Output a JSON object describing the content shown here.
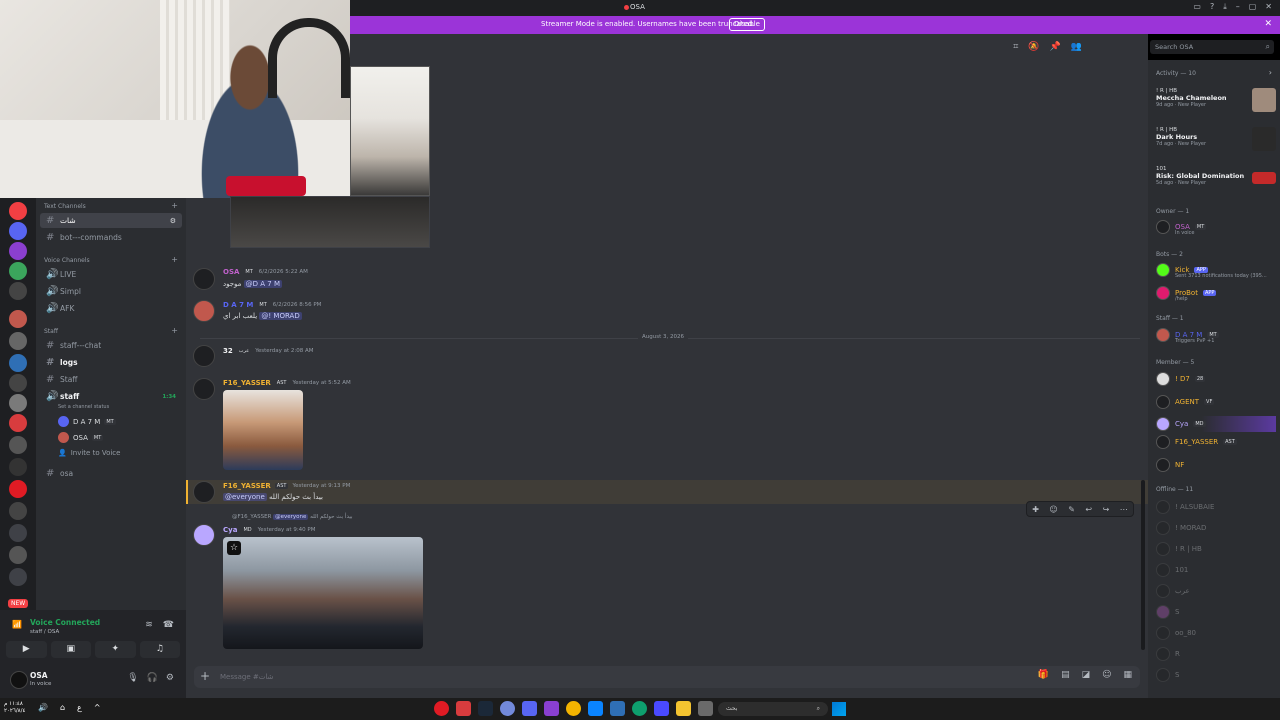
{
  "window": {
    "title": "OSA"
  },
  "banner": {
    "text": "Streamer Mode is enabled. Usernames have been truncated.",
    "button": "Disable"
  },
  "server_rail": {
    "new_badge": "NEW"
  },
  "channels": {
    "text_category": "Text Channels",
    "text_items": [
      {
        "name": "شات",
        "active": true
      },
      {
        "name": "bot---commands",
        "active": false
      }
    ],
    "voice_category": "Voice Channels",
    "voice_items": [
      "LIVE",
      "Simpl",
      "AFK"
    ],
    "staff_category": "Staff",
    "staff_items": [
      "staff---chat",
      "logs",
      "Staff"
    ],
    "staff_voice": {
      "name": "staff",
      "timer": "1:34",
      "status": "Set a channel status"
    },
    "voice_users": [
      {
        "name": "D A 7 M",
        "tag": "MT"
      },
      {
        "name": "OSA",
        "tag": "MT"
      }
    ],
    "invite": "Invite to Voice",
    "last_item": "osa"
  },
  "voice_panel": {
    "title": "Voice Connected",
    "subtitle": "staff / OSA"
  },
  "user_panel": {
    "name": "OSA",
    "status": "In voice"
  },
  "search": {
    "placeholder": "Search OSA"
  },
  "messages": [
    {
      "user": "OSA",
      "tag": "MT",
      "time": "6/2/2026 5:22 AM",
      "body": "موجود",
      "mention": "@D A 7 M"
    },
    {
      "user": "D A 7 M",
      "tag": "MT",
      "time": "6/2/2026 8:56 PM",
      "body": "يلعب ابر اي",
      "mention": "@! MORAD"
    },
    {
      "user": "32",
      "tag": "عرب",
      "time": "Yesterday at 2:08 AM"
    },
    {
      "user": "F16_YASSER",
      "tag": "AST",
      "time": "Yesterday at 5:52 AM"
    },
    {
      "user": "F16_YASSER",
      "tag": "AST",
      "time": "Yesterday at 9:13 PM",
      "mention": "@everyone",
      "body": "بيدأ بث حولكم الله"
    },
    {
      "user": "Cya",
      "tag": "MD",
      "time": "Yesterday at 9:40 PM",
      "reply_user": "@F16_YASSER",
      "reply_mention": "@everyone",
      "reply_body": "بيدأ بث حولكم الله"
    }
  ],
  "date_separator": "August 3, 2026",
  "composer": {
    "placeholder": "Message #شات"
  },
  "members": {
    "activity_header": "Activity — 10",
    "activities": [
      {
        "tag": "! R | HB",
        "title": "Meccha Chameleon",
        "sub": "9d ago · New Player"
      },
      {
        "tag": "! R | HB",
        "title": "Dark Hours",
        "sub": "7d ago · New Player"
      },
      {
        "tag": "101",
        "title": "Risk: Global Domination",
        "sub": "5d ago · New Player"
      }
    ],
    "owner_header": "Owner — 1",
    "owner": {
      "name": "OSA",
      "tag": "MT",
      "sub": "In voice"
    },
    "bots_header": "Bots — 2",
    "bots": [
      {
        "name": "Kick",
        "badge": "APP",
        "sub": "Sent 3713 notifications today (395..."
      },
      {
        "name": "ProBot",
        "badge": "APP",
        "sub": "/help"
      }
    ],
    "staff_header": "Staff — 1",
    "staff": {
      "name": "D A 7 M",
      "tag": "MT",
      "sub": "Triggers PvP +1"
    },
    "member_header": "Member — 5",
    "member_list": [
      {
        "name": "! D7",
        "tag": "28"
      },
      {
        "name": "AGENT",
        "tag": "VF"
      },
      {
        "name": "Cya",
        "tag": "MD"
      },
      {
        "name": "F16_YASSER",
        "tag": "AST"
      },
      {
        "name": "NF",
        "tag": ""
      }
    ],
    "offline_header": "Offline — 11",
    "offline_list": [
      "! ALSUBAIE",
      "! MORAD",
      "! R | HB",
      "101",
      "عرب",
      "S",
      "oo_80",
      "R",
      "S"
    ]
  },
  "taskbar": {
    "search": "بحث",
    "clock": "١١:٤٨ م",
    "date": "٢٠٢٦/٨/٤"
  },
  "colors": {
    "banner": "#9b34d8",
    "owner": "#c061cb",
    "staff": "#5865f2",
    "member_gold": "#f0b232",
    "kick": "#53fc18",
    "yasser": "#f0b232",
    "cya": "#b9a7ff"
  }
}
